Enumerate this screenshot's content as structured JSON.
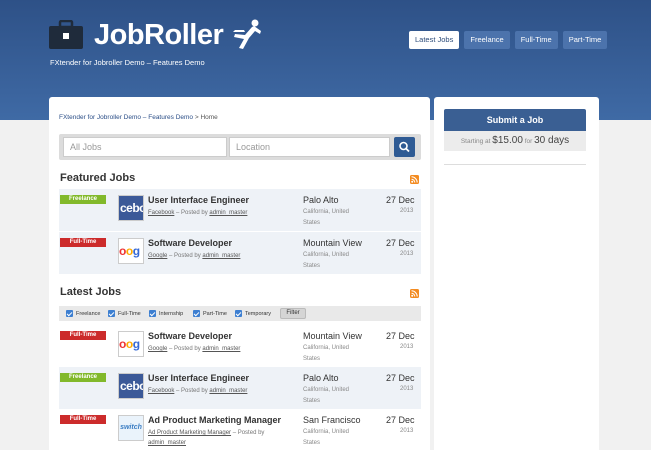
{
  "header": {
    "logo_text": "JobRoller",
    "tagline": "FXtender for Jobroller Demo – Features Demo",
    "nav": [
      "Latest Jobs",
      "Freelance",
      "Full-Time",
      "Part-Time"
    ]
  },
  "breadcrumb": {
    "site": "FXtender for Jobroller Demo – Features Demo",
    "separator": ">",
    "current": "Home"
  },
  "search": {
    "jobs_placeholder": "All Jobs",
    "location_placeholder": "Location"
  },
  "featured": {
    "title": "Featured Jobs",
    "jobs": [
      {
        "type": "Freelance",
        "title": "User Interface Engineer",
        "company": "Facebook",
        "posted_by": "– Posted by",
        "author": "admin_master",
        "location": "Palo Alto",
        "region": "California, United States",
        "day": "27 Dec",
        "year": "2013"
      },
      {
        "type": "Full-Time",
        "title": "Software Developer",
        "company": "Google",
        "posted_by": "– Posted by",
        "author": "admin_master",
        "location": "Mountain View",
        "region": "California, United States",
        "day": "27 Dec",
        "year": "2013"
      }
    ]
  },
  "latest": {
    "title": "Latest Jobs",
    "filters": [
      "Freelance",
      "Full-Time",
      "Internship",
      "Part-Time",
      "Temporary"
    ],
    "filter_button": "Filter",
    "jobs": [
      {
        "type": "Full-Time",
        "title": "Software Developer",
        "company": "Google",
        "posted_by": "– Posted by",
        "author": "admin_master",
        "location": "Mountain View",
        "region": "California, United States",
        "day": "27 Dec",
        "year": "2013"
      },
      {
        "type": "Freelance",
        "title": "User Interface Engineer",
        "company": "Facebook",
        "posted_by": "– Posted by",
        "author": "admin_master",
        "location": "Palo Alto",
        "region": "California, United States",
        "day": "27 Dec",
        "year": "2013"
      },
      {
        "type": "Full-Time",
        "title": "Ad Product Marketing Manager",
        "company": "Ad Product Marketing Manager",
        "posted_by": "– Posted by",
        "author": "admin_master",
        "location": "San Francisco",
        "region": "California, United States",
        "day": "27 Dec",
        "year": "2013"
      }
    ]
  },
  "sidebar": {
    "submit_label": "Submit a Job",
    "price_prefix": "Starting at",
    "price": "$15.00",
    "price_for": "for",
    "duration": "30 days"
  },
  "logos": {
    "facebook": "cebo",
    "software": "switch"
  },
  "colors": {
    "header": "#3a619b",
    "freelance": "#82b92b",
    "fulltime": "#cc2b2b",
    "accent": "#2f5b94"
  }
}
